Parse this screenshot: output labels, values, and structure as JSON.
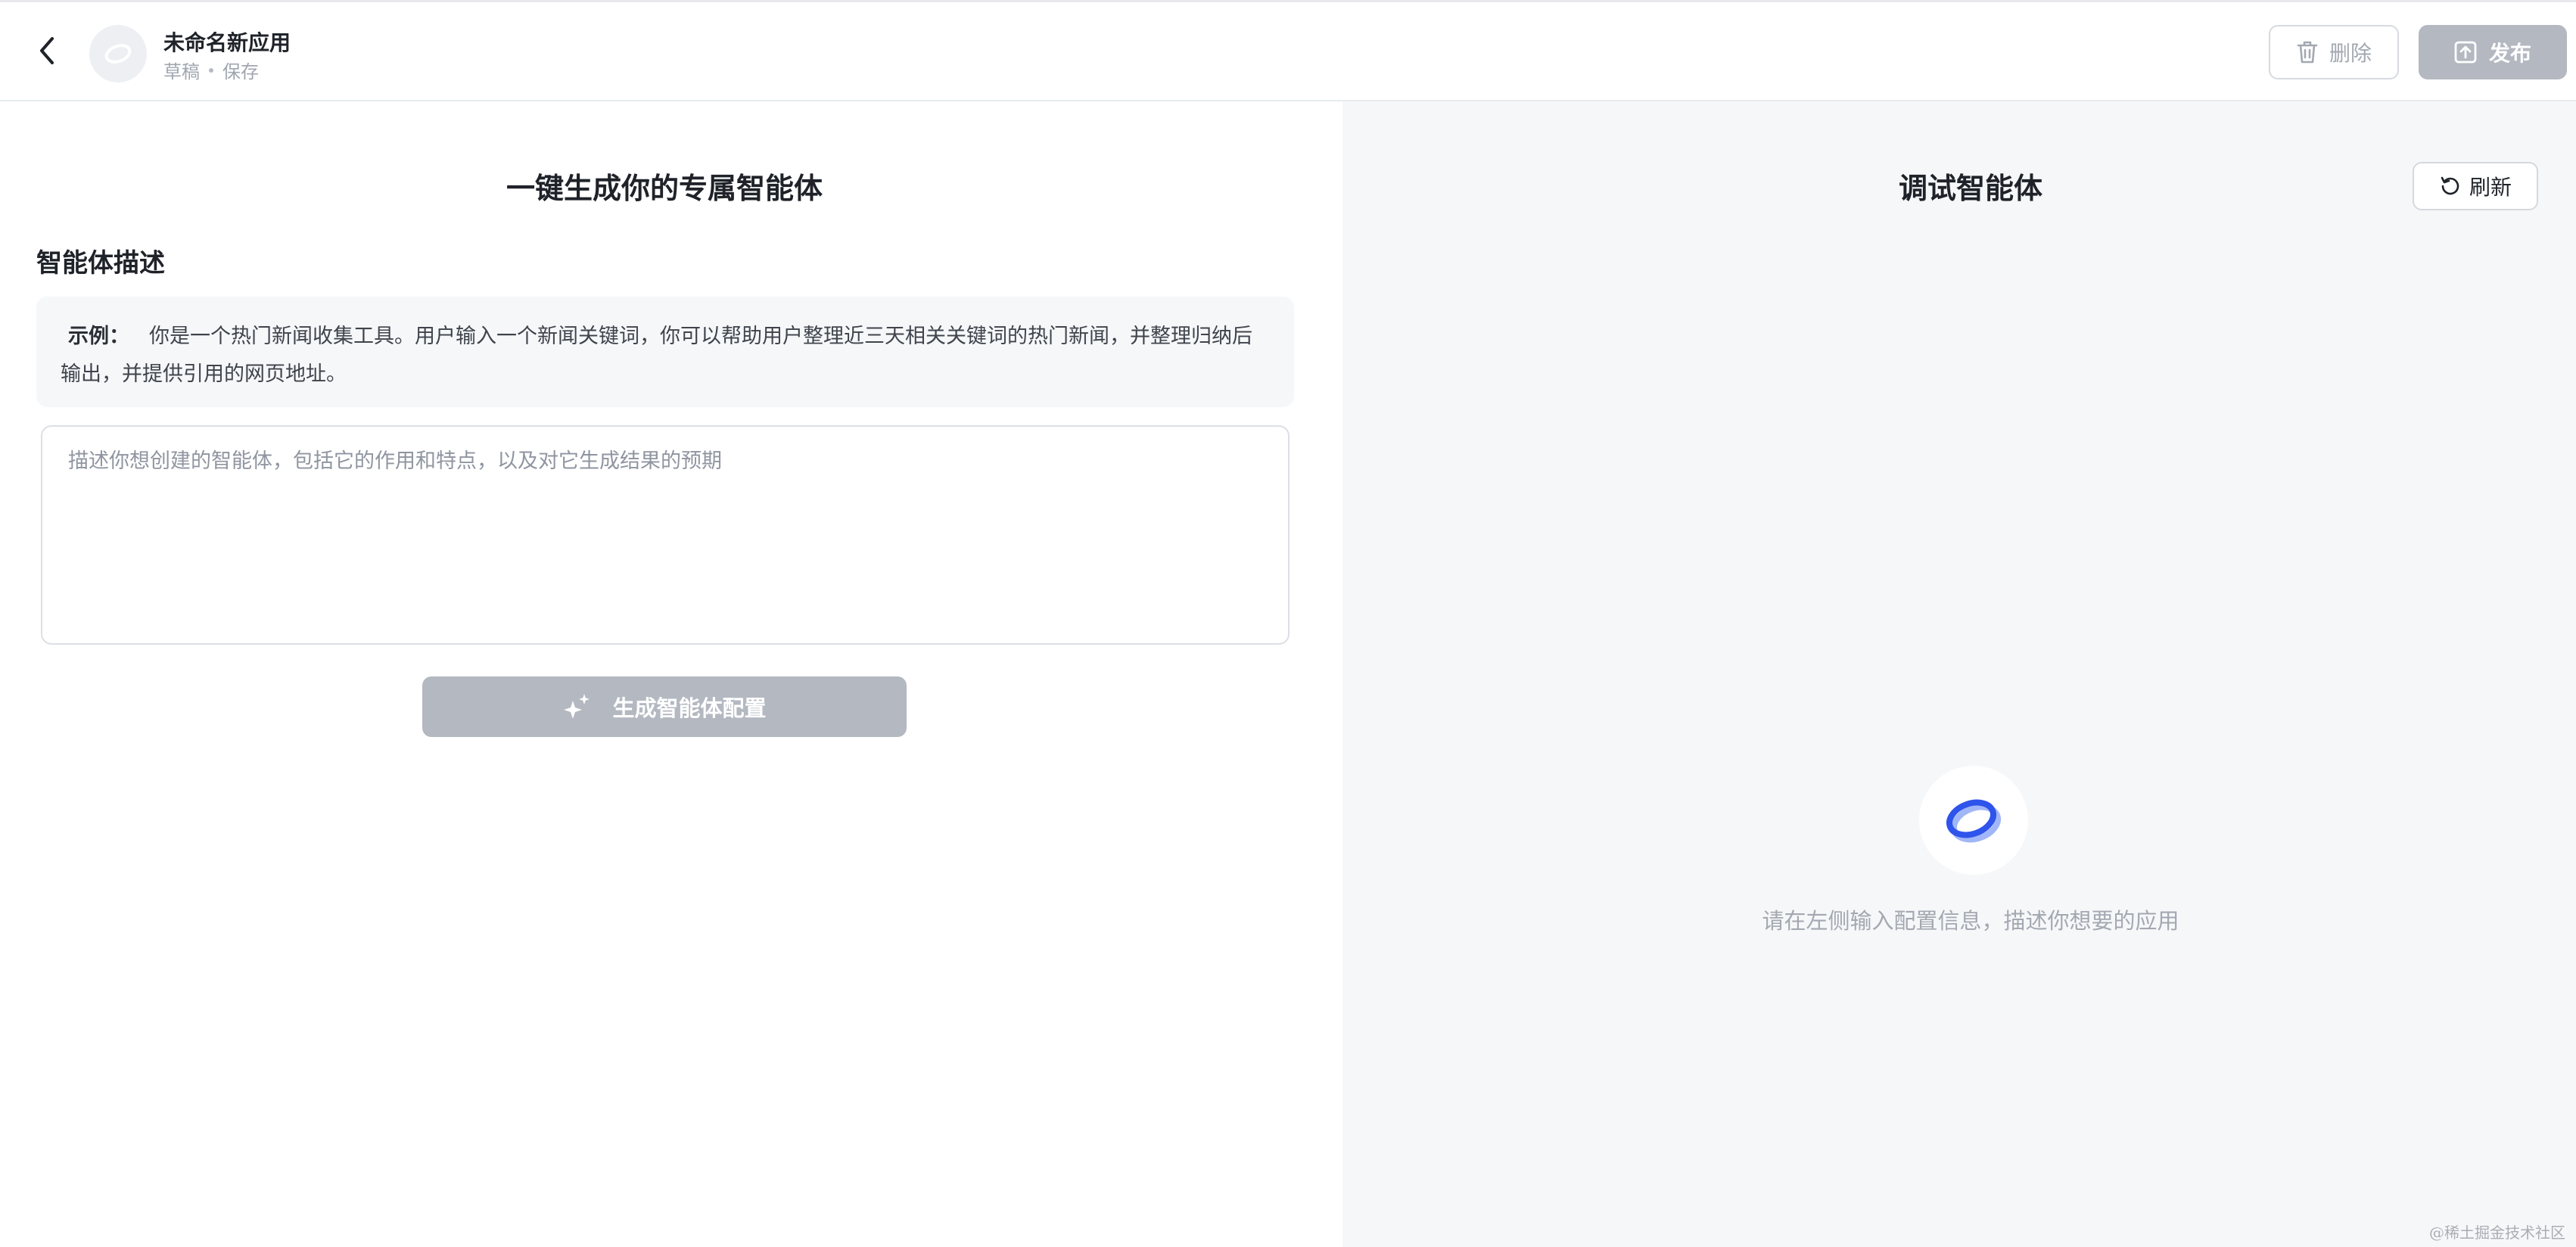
{
  "header": {
    "app_name": "未命名新应用",
    "status": "草稿",
    "save_label": "保存",
    "delete_label": "删除",
    "publish_label": "发布"
  },
  "left": {
    "title": "一键生成你的专属智能体",
    "section_title": "智能体描述",
    "example_label": "示例：",
    "example_text": "你是一个热门新闻收集工具。用户输入一个新闻关键词，你可以帮助用户整理近三天相关关键词的热门新闻，并整理归纳后输出，并提供引用的网页地址。",
    "input_placeholder": "描述你想创建的智能体，包括它的作用和特点，以及对它生成结果的预期",
    "generate_label": "生成智能体配置"
  },
  "right": {
    "title": "调试智能体",
    "refresh_label": "刷新",
    "empty_text": "请在左侧输入配置信息，描述你想要的应用"
  },
  "footer": {
    "corner_mark": "@稀土掘金技术社区"
  },
  "colors": {
    "accent": "#2f54eb",
    "disabled_button": "#b3b8c1",
    "right_bg": "#f6f7f9"
  },
  "icons": {
    "back": "chevron-left-icon",
    "avatar": "app-logo-icon",
    "delete": "trash-icon",
    "publish": "upload-icon",
    "generate": "sparkle-icon",
    "refresh": "refresh-icon",
    "empty": "ring-logo-icon"
  }
}
